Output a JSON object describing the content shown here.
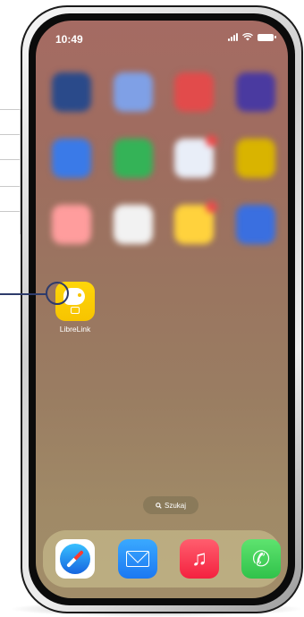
{
  "status_bar": {
    "time": "10:49",
    "icons": [
      "signal-icon",
      "wifi-icon",
      "battery-icon"
    ]
  },
  "blurred_apps": [
    [
      "#2a4a8a",
      "#7fa0e6",
      "#e24b4b",
      "#4a3aa0"
    ],
    [
      "#3a7ae8",
      "#34b357",
      "#e9eef8",
      "#d9b400"
    ],
    [
      "#ff9d9d",
      "#f2f2f2",
      "#ffd23d",
      "#3a6fe0"
    ]
  ],
  "featured_app": {
    "label": "LibreLink",
    "icon": "librelink-icon",
    "color": "#ffd60a"
  },
  "search": {
    "label": "Szukaj",
    "icon": "search-icon"
  },
  "dock": [
    {
      "name": "safari-icon"
    },
    {
      "name": "mail-icon"
    },
    {
      "name": "music-icon"
    },
    {
      "name": "phone-icon"
    }
  ],
  "colors": {
    "pointer": "#2e3b6b",
    "wallpaper_top": "#a56b63",
    "wallpaper_bottom": "#a18d69"
  }
}
